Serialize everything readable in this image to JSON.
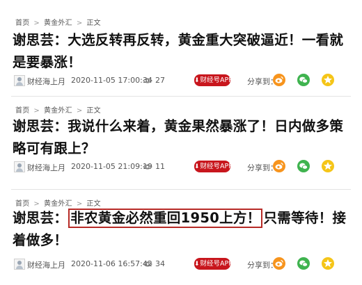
{
  "breadcrumb": {
    "home": "首页",
    "category": "黄金外汇",
    "current": "正文",
    "separator": ">"
  },
  "articles": [
    {
      "title_before": "谢思芸：大选反转再反转，黄金重大突破逼近！一看就是要暴涨！",
      "title_highlight": "",
      "title_after": "",
      "author": "财经海上月",
      "datetime": "2020-11-05 17:00:34",
      "views": "27",
      "app_button": "财经号APP",
      "share_label": "分享到："
    },
    {
      "title_before": "谢思芸：我说什么来着，黄金果然暴涨了！日内做多策略可有跟上？",
      "title_highlight": "",
      "title_after": "",
      "author": "财经海上月",
      "datetime": "2020-11-05 21:09:19",
      "views": "11",
      "app_button": "财经号APP",
      "share_label": "分享到："
    },
    {
      "title_before": "谢思芸：",
      "title_highlight": "非农黄金必然重回1950上方！",
      "title_after": "只需等待！接着做多！",
      "author": "财经海上月",
      "datetime": "2020-11-06 16:57:42",
      "views": "34",
      "app_button": "财经号APP",
      "share_label": "分享到："
    }
  ],
  "icons": {
    "view": "eye-icon",
    "download": "download-icon",
    "weibo": "weibo-icon",
    "wechat": "wechat-icon",
    "qzone": "qzone-icon",
    "avatar": "avatar-icon"
  },
  "colors": {
    "app_button": "#c8161d",
    "highlight_border": "#b72a26",
    "weibo": "#f7941d",
    "wechat": "#3fb34f",
    "qzone": "#f5c518"
  }
}
